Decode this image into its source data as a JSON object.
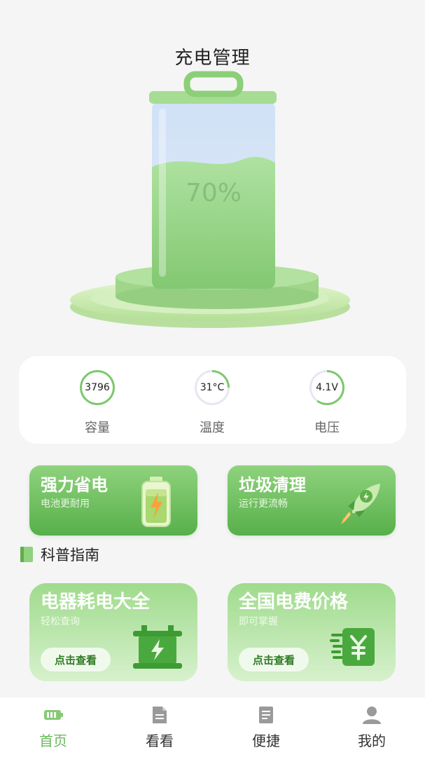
{
  "header": {
    "title": "充电管理"
  },
  "battery": {
    "percent_text": "70%",
    "level": 0.7
  },
  "stats": [
    {
      "value": "3796",
      "label": "容量",
      "progress": 1.0
    },
    {
      "value": "31°C",
      "label": "温度",
      "progress": 0.25
    },
    {
      "value": "4.1V",
      "label": "电压",
      "progress": 0.6
    }
  ],
  "features": [
    {
      "title": "强力省电",
      "subtitle": "电池更耐用",
      "icon": "battery-charging-icon"
    },
    {
      "title": "垃圾清理",
      "subtitle": "运行更流畅",
      "icon": "rocket-icon"
    }
  ],
  "section": {
    "title": "科普指南",
    "icon": "book-icon"
  },
  "guides": [
    {
      "title": "电器耗电大全",
      "subtitle": "轻松查询",
      "button": "点击查看",
      "icon": "power-appliance-icon"
    },
    {
      "title": "全国电费价格",
      "subtitle": "即可掌握",
      "button": "点击查看",
      "icon": "yuan-price-icon"
    }
  ],
  "tabs": [
    {
      "label": "首页",
      "icon": "battery-icon",
      "active": true
    },
    {
      "label": "看看",
      "icon": "document-icon",
      "active": false
    },
    {
      "label": "便捷",
      "icon": "list-icon",
      "active": false
    },
    {
      "label": "我的",
      "icon": "user-icon",
      "active": false
    }
  ],
  "colors": {
    "accent": "#6ab95c",
    "card_green": "#57b04a",
    "background": "#f5f5f5"
  }
}
